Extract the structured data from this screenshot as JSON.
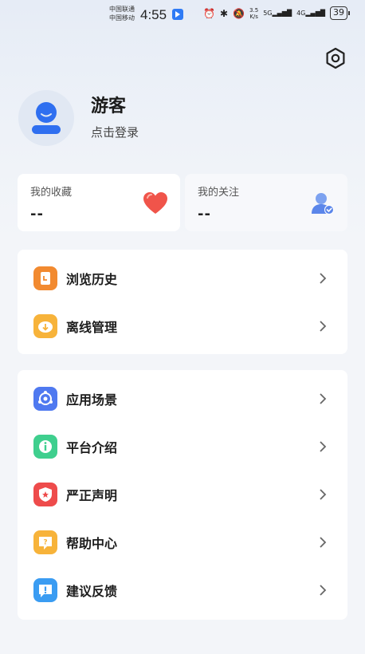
{
  "status_bar": {
    "carrier_1": "中国联通",
    "carrier_2": "中国移动",
    "time": "4:55",
    "net_speed_value": "3.5",
    "net_speed_unit": "K/s",
    "signal_1": "5G",
    "signal_2": "4G",
    "battery": "39"
  },
  "profile": {
    "name": "游客",
    "login_text": "点击登录"
  },
  "stats": {
    "favorites_label": "我的收藏",
    "favorites_value": "--",
    "following_label": "我的关注",
    "following_value": "--"
  },
  "menu_group_1": [
    {
      "label": "浏览历史",
      "icon": "history-icon",
      "color": "#f28a30"
    },
    {
      "label": "离线管理",
      "icon": "download-icon",
      "color": "#f7b33a"
    }
  ],
  "menu_group_2": [
    {
      "label": "应用场景",
      "icon": "scenario-icon",
      "color": "#4f79f0"
    },
    {
      "label": "平台介绍",
      "icon": "info-icon",
      "color": "#3fcf8e"
    },
    {
      "label": "严正声明",
      "icon": "shield-icon",
      "color": "#ee4b4b"
    },
    {
      "label": "帮助中心",
      "icon": "help-icon",
      "color": "#f7b33a"
    },
    {
      "label": "建议反馈",
      "icon": "feedback-icon",
      "color": "#3a9cf2"
    }
  ],
  "colors": {
    "background": "#f3f5f9",
    "accent_blue": "#2f6ff0",
    "heart": "#f0544a"
  }
}
